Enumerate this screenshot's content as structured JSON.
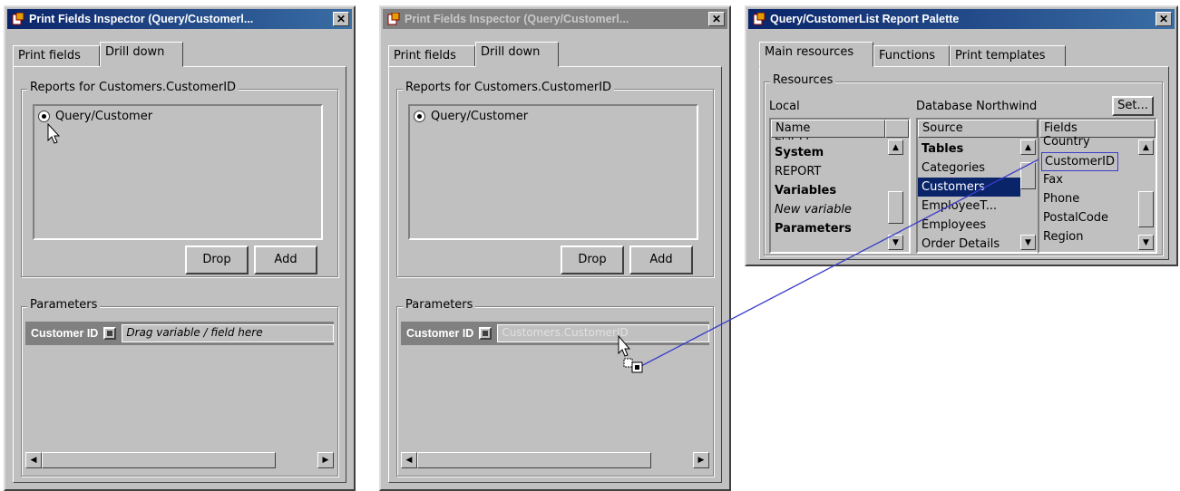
{
  "inspector_left": {
    "title": "Print Fields Inspector (Query/Customerl...",
    "tabs": [
      "Print fields",
      "Drill down"
    ],
    "reports_group_label": "Reports for Customers.CustomerID",
    "report_item": "Query/Customer",
    "drop_label": "Drop",
    "add_label": "Add",
    "parameters_label": "Parameters",
    "param_name": "Customer ID",
    "param_value": "Drag variable / field here"
  },
  "inspector_right": {
    "title": "Print Fields Inspector (Query/Customerl...",
    "tabs": [
      "Print fields",
      "Drill down"
    ],
    "reports_group_label": "Reports for Customers.CustomerID",
    "report_item": "Query/Customer",
    "drop_label": "Drop",
    "add_label": "Add",
    "parameters_label": "Parameters",
    "param_name": "Customer ID",
    "param_value": "Customers.CustomerID"
  },
  "palette": {
    "title": "Query/CustomerList Report Palette",
    "tabs": [
      "Main resources",
      "Functions",
      "Print templates"
    ],
    "resources_label": "Resources",
    "local_label": "Local",
    "database_label": "Database Northwind",
    "set_label": "Set...",
    "name_header": "Name",
    "source_header": "Source",
    "fields_header": "Fields",
    "name_items": [
      {
        "text": "EMPTY",
        "style": "partial"
      },
      {
        "text": "System",
        "style": "bold"
      },
      {
        "text": "REPORT",
        "style": "normal"
      },
      {
        "text": "Variables",
        "style": "bold"
      },
      {
        "text": "New variable",
        "style": "italic"
      },
      {
        "text": "Parameters",
        "style": "bold"
      }
    ],
    "source_items": [
      {
        "text": "Tables",
        "style": "bold"
      },
      {
        "text": "Categories",
        "style": "normal"
      },
      {
        "text": "Customers",
        "style": "selected"
      },
      {
        "text": "EmployeeT...",
        "style": "normal"
      },
      {
        "text": "Employees",
        "style": "normal"
      },
      {
        "text": "Order Details",
        "style": "normal"
      }
    ],
    "field_items": [
      {
        "text": "Country",
        "style": "normal"
      },
      {
        "text": "CustomerID",
        "style": "boxed"
      },
      {
        "text": "Fax",
        "style": "normal"
      },
      {
        "text": "Phone",
        "style": "normal"
      },
      {
        "text": "PostalCode",
        "style": "normal"
      },
      {
        "text": "Region",
        "style": "normal"
      }
    ]
  },
  "colors": {
    "face": "#c0c0c0",
    "title_active": "#0a246a",
    "title_inactive": "#808080",
    "selection": "#0a246a",
    "drag_line": "#3c3cc8"
  }
}
